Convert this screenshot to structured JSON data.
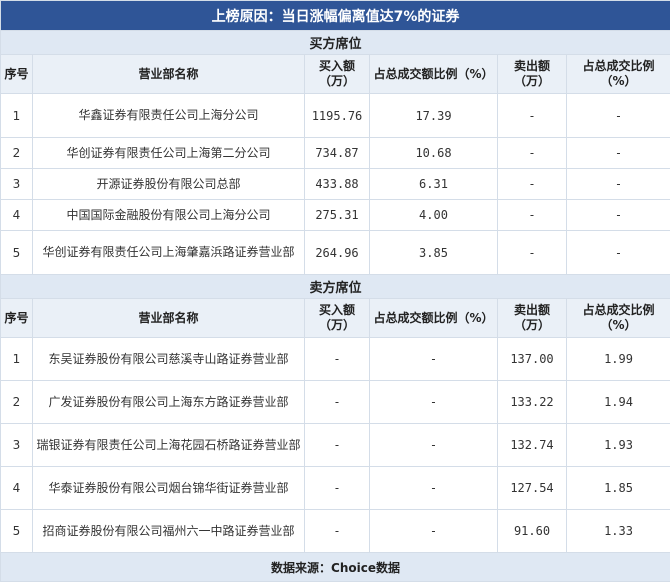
{
  "title": "上榜原因：当日涨幅偏离值达7%的证券",
  "buy_section": {
    "label": "买方席位",
    "headers": [
      "序号",
      "营业部名称",
      "买入额（万）",
      "占总成交额比例（%）",
      "卖出额（万）",
      "占总成交比例（%）"
    ],
    "rows": [
      {
        "idx": "1",
        "name": "华鑫证券有限责任公司上海分公司",
        "buy": "1195.76",
        "buy_pct": "17.39",
        "sell": "-",
        "sell_pct": "-"
      },
      {
        "idx": "2",
        "name": "华创证券有限责任公司上海第二分公司",
        "buy": "734.87",
        "buy_pct": "10.68",
        "sell": "-",
        "sell_pct": "-"
      },
      {
        "idx": "3",
        "name": "开源证券股份有限公司总部",
        "buy": "433.88",
        "buy_pct": "6.31",
        "sell": "-",
        "sell_pct": "-"
      },
      {
        "idx": "4",
        "name": "中国国际金融股份有限公司上海分公司",
        "buy": "275.31",
        "buy_pct": "4.00",
        "sell": "-",
        "sell_pct": "-"
      },
      {
        "idx": "5",
        "name": "华创证券有限责任公司上海肇嘉浜路证券营业部",
        "buy": "264.96",
        "buy_pct": "3.85",
        "sell": "-",
        "sell_pct": "-"
      }
    ]
  },
  "sell_section": {
    "label": "卖方席位",
    "headers": [
      "序号",
      "营业部名称",
      "买入额（万）",
      "占总成交额比例（%）",
      "卖出额（万）",
      "占总成交比例（%）"
    ],
    "rows": [
      {
        "idx": "1",
        "name": "东吴证券股份有限公司慈溪寺山路证券营业部",
        "buy": "-",
        "buy_pct": "-",
        "sell": "137.00",
        "sell_pct": "1.99"
      },
      {
        "idx": "2",
        "name": "广发证券股份有限公司上海东方路证券营业部",
        "buy": "-",
        "buy_pct": "-",
        "sell": "133.22",
        "sell_pct": "1.94"
      },
      {
        "idx": "3",
        "name": "瑞银证券有限责任公司上海花园石桥路证券营业部",
        "buy": "-",
        "buy_pct": "-",
        "sell": "132.74",
        "sell_pct": "1.93"
      },
      {
        "idx": "4",
        "name": "华泰证券股份有限公司烟台锦华街证券营业部",
        "buy": "-",
        "buy_pct": "-",
        "sell": "127.54",
        "sell_pct": "1.85"
      },
      {
        "idx": "5",
        "name": "招商证券股份有限公司福州六一中路证券营业部",
        "buy": "-",
        "buy_pct": "-",
        "sell": "91.60",
        "sell_pct": "1.33"
      }
    ]
  },
  "footer": "数据来源：Choice数据"
}
